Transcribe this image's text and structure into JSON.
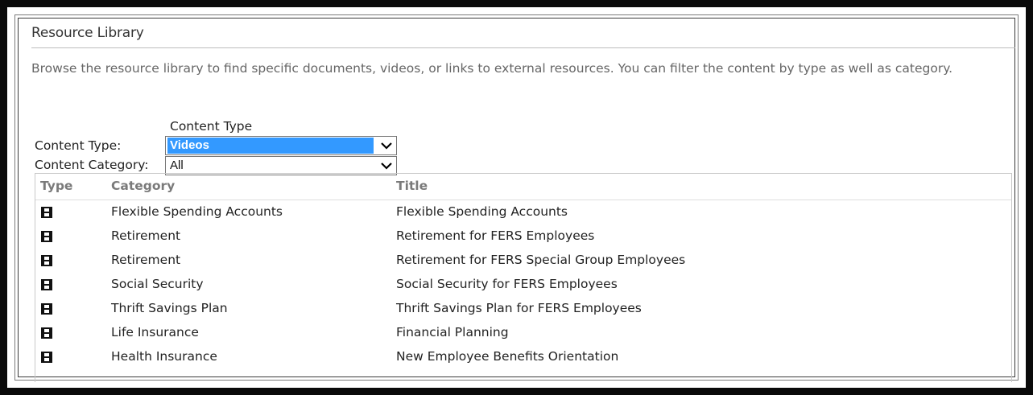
{
  "web_part": {
    "title": "Resource Library",
    "description": "Browse the resource library to find specific documents, videos, or links to external resources. You can filter the content by type as well as category."
  },
  "filters": {
    "heading": "Content Type",
    "content_type": {
      "label": "Content Type:",
      "selected": "Videos"
    },
    "content_category": {
      "label": "Content Category:",
      "selected": "All"
    }
  },
  "table": {
    "columns": {
      "type": "Type",
      "category": "Category",
      "title": "Title"
    },
    "rows": [
      {
        "type_icon": "film-icon",
        "category": "Flexible Spending Accounts",
        "title": "Flexible Spending Accounts"
      },
      {
        "type_icon": "film-icon",
        "category": "Retirement",
        "title": "Retirement for FERS Employees"
      },
      {
        "type_icon": "film-icon",
        "category": "Retirement",
        "title": "Retirement for FERS Special Group Employees"
      },
      {
        "type_icon": "film-icon",
        "category": "Social Security",
        "title": "Social Security for FERS Employees"
      },
      {
        "type_icon": "film-icon",
        "category": "Thrift Savings Plan",
        "title": "Thrift Savings Plan for FERS Employees"
      },
      {
        "type_icon": "film-icon",
        "category": "Life Insurance",
        "title": "Financial Planning"
      },
      {
        "type_icon": "film-icon",
        "category": "Health Insurance",
        "title": "New Employee Benefits Orientation"
      }
    ]
  },
  "colors": {
    "selection_highlight": "#3399ff",
    "frame": "#0a0a0a",
    "description_text": "#666666",
    "header_text": "#7a7a7a"
  }
}
